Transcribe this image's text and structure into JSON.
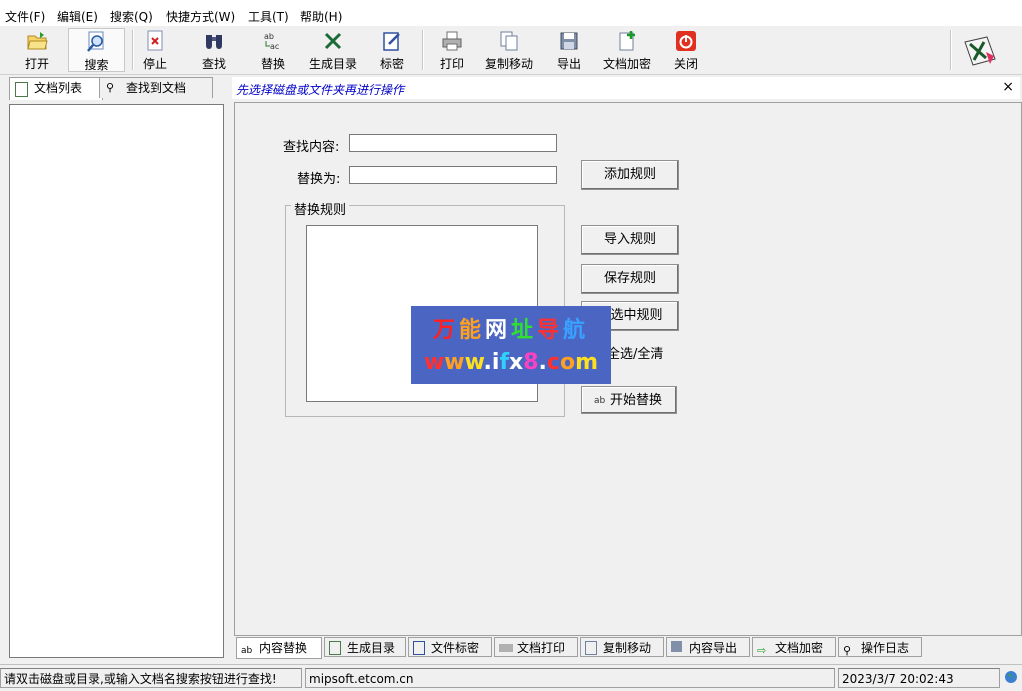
{
  "menu": [
    "文件(F)",
    "编辑(E)",
    "搜索(Q)",
    "快捷方式(W)",
    "工具(T)",
    "帮助(H)"
  ],
  "toolbar": {
    "open": "打开",
    "search": "搜索",
    "stop": "停止",
    "find": "查找",
    "replace": "替换",
    "toc": "生成目录",
    "tag": "标密",
    "print": "打印",
    "copymove": "复制移动",
    "export": "导出",
    "encrypt": "文档加密",
    "close": "关闭"
  },
  "left_tabs": [
    "文档列表",
    "查找到文档"
  ],
  "header": {
    "hint": "先选择磁盘或文件夹再进行操作",
    "close": "×"
  },
  "form": {
    "find_label": "查找内容:",
    "replace_label": "替换为:",
    "find_value": "",
    "replace_value": "",
    "group_title": "替换规则",
    "buttons": {
      "add": "添加规则",
      "import": "导入规则",
      "save": "保存规则",
      "delete": "除选中规则",
      "toggle": "全选/全清",
      "start": "开始替换"
    }
  },
  "watermark": {
    "line1": "万能网址导航",
    "line2": "www.ifx8.com"
  },
  "bottom_tabs": [
    "内容替换",
    "生成目录",
    "文件标密",
    "文档打印",
    "复制移动",
    "内容导出",
    "文档加密",
    "操作日志"
  ],
  "status": {
    "hint": "请双击磁盘或目录,或输入文档名搜索按钮进行查找!",
    "site": "mipsoft.etcom.cn",
    "datetime": "2023/3/7 20:02:43"
  },
  "colors": {
    "hint_text": "#0000c8",
    "watermark_bg": "#4b66c2"
  }
}
